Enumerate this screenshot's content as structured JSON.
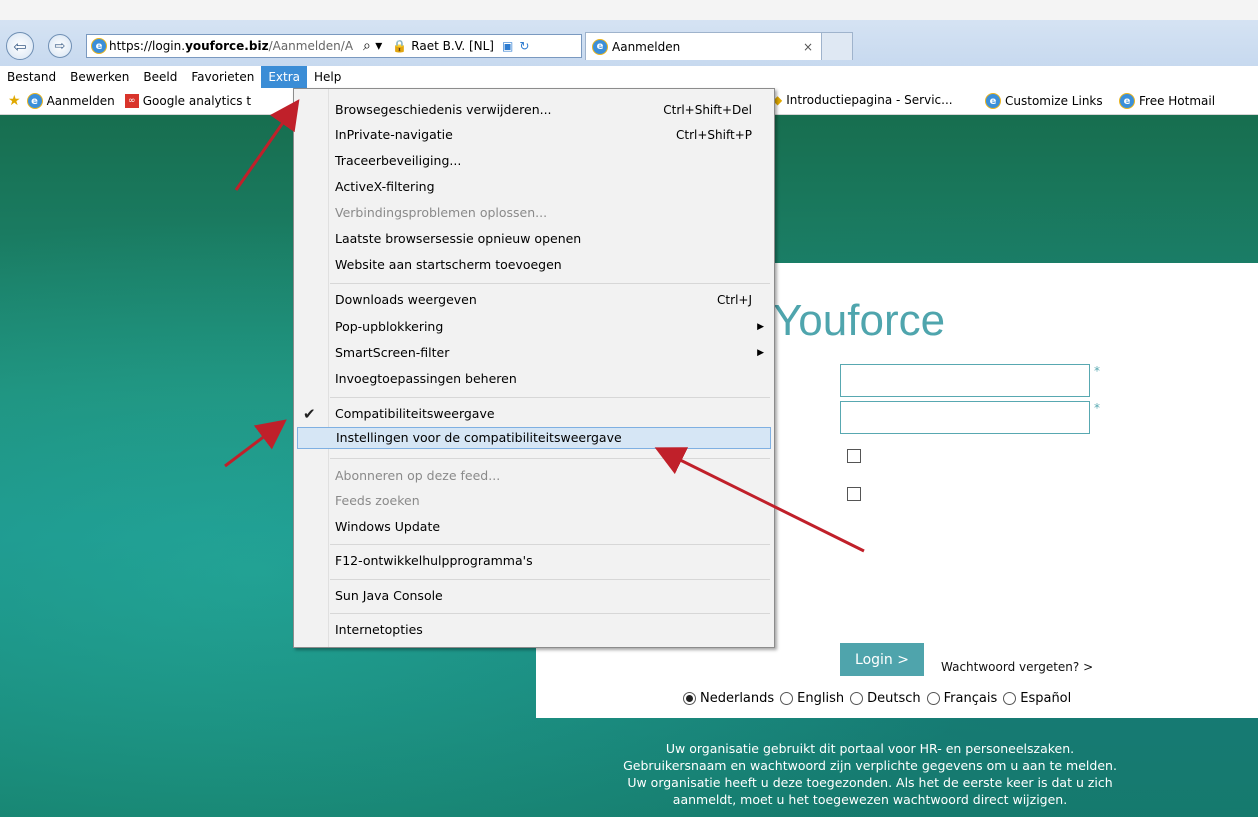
{
  "browser": {
    "url_prefix": "https://login.",
    "url_domain": "youforce.biz",
    "url_rest": "/Aanmelden/A",
    "search_glyph": "⌕ ▾",
    "site_identity": "Raet B.V. [NL]",
    "tab_title": "Aanmelden",
    "tab_close": "×"
  },
  "menubar": {
    "items": [
      "Bestand",
      "Bewerken",
      "Beeld",
      "Favorieten",
      "Extra",
      "Help"
    ]
  },
  "favorites": {
    "left": [
      "Aanmelden",
      "Google analytics t"
    ],
    "right": [
      "Introductiepagina - Servic...",
      "Customize Links",
      "Free Hotmail"
    ]
  },
  "extra_menu": {
    "group1": [
      {
        "label": "Browsegeschiedenis verwijderen...",
        "shortcut": "Ctrl+Shift+Del"
      },
      {
        "label": "InPrivate-navigatie",
        "shortcut": "Ctrl+Shift+P"
      },
      {
        "label": "Traceerbeveiliging...",
        "shortcut": ""
      },
      {
        "label": "ActiveX-filtering",
        "shortcut": ""
      },
      {
        "label": "Verbindingsproblemen oplossen...",
        "shortcut": "",
        "disabled": true
      },
      {
        "label": "Laatste browsersessie opnieuw openen",
        "shortcut": ""
      },
      {
        "label": "Website aan startscherm toevoegen",
        "shortcut": ""
      }
    ],
    "group2": [
      {
        "label": "Downloads weergeven",
        "shortcut": "Ctrl+J"
      },
      {
        "label": "Pop-upblokkering",
        "submenu": true
      },
      {
        "label": "SmartScreen-filter",
        "submenu": true
      },
      {
        "label": "Invoegtoepassingen beheren"
      }
    ],
    "group3": [
      {
        "label": "Compatibiliteitsweergave",
        "checked": true
      },
      {
        "label": "Instellingen voor de compatibiliteitsweergave",
        "highlighted": true
      }
    ],
    "group4": [
      {
        "label": "Abonneren op deze feed...",
        "disabled": true
      },
      {
        "label": "Feeds zoeken",
        "disabled": true
      },
      {
        "label": "Windows Update"
      }
    ],
    "group5": [
      {
        "label": "F12-ontwikkelhulpprogramma's"
      }
    ],
    "group6": [
      {
        "label": "Sun Java Console"
      }
    ],
    "group7": [
      {
        "label": "Internetopties"
      }
    ]
  },
  "login": {
    "brand": "Youforce",
    "required_marker": "*",
    "login_button": "Login  >",
    "forgot": "Wachtwoord vergeten? >",
    "languages": [
      "Nederlands",
      "English",
      "Deutsch",
      "Français",
      "Español"
    ],
    "selected_language": "Nederlands"
  },
  "footer": {
    "lines": [
      "Uw organisatie gebruikt dit portaal voor HR- en personeelszaken.",
      "Gebruikersnaam en wachtwoord zijn verplichte gegevens om u aan te melden.",
      "Uw organisatie heeft u deze toegezonden. Als het de eerste keer is dat u zich",
      "aanmeldt, moet u het toegewezen wachtwoord direct wijzigen."
    ]
  },
  "colors": {
    "accent": "#4fa4ac",
    "menu_highlight": "#d6e6f5",
    "annotation_arrow": "#c0202a"
  }
}
